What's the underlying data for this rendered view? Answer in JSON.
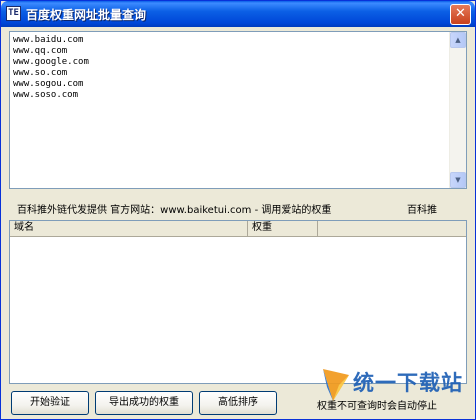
{
  "window": {
    "title": "百度权重网址批量查询",
    "icon_glyph": "TE",
    "close_glyph": "✕"
  },
  "url_input": {
    "value": "www.baidu.com\nwww.qq.com\nwww.google.com\nwww.so.com\nwww.sogou.com\nwww.soso.com"
  },
  "scrollbar": {
    "up_glyph": "▲",
    "down_glyph": "▼"
  },
  "info": {
    "left": "百科推外链代发提供 官方网站：www.baiketui.com - 调用爱站的权重",
    "right": "百科推"
  },
  "results": {
    "columns": [
      "域名",
      "权重"
    ]
  },
  "buttons": {
    "start": "开始验证",
    "export": "导出成功的权重",
    "sort": "高低排序"
  },
  "status": {
    "text": "权重不可查询时会自动停止"
  },
  "watermark": {
    "text": "统一下载站"
  },
  "colors": {
    "titlebar": "#0b5fe5",
    "window_bg": "#ece9d8",
    "field_border": "#7f9db9",
    "button_border": "#003c74",
    "watermark": "#1d5fb5"
  }
}
